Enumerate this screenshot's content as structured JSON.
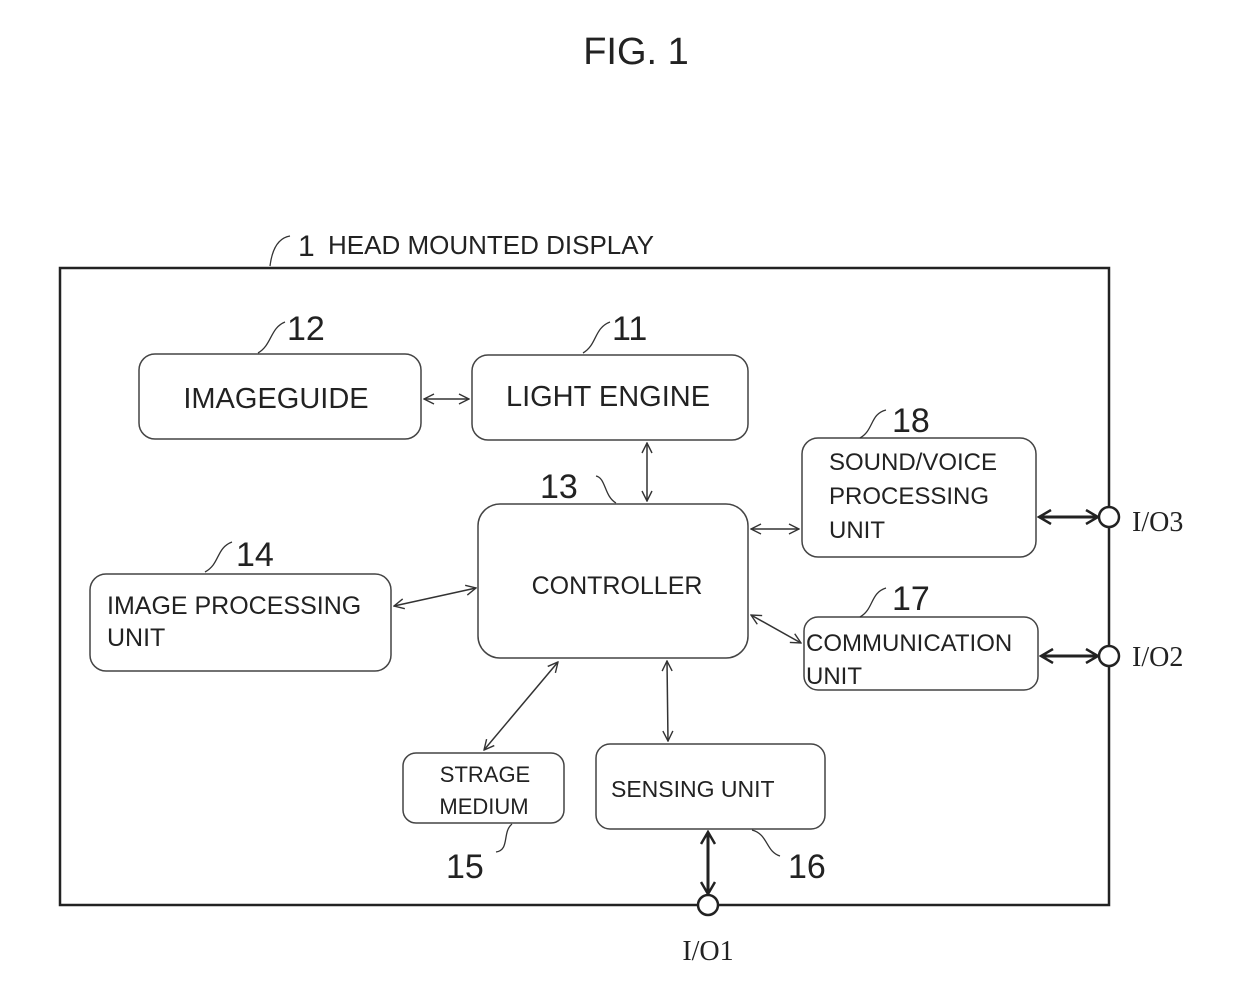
{
  "figure": {
    "title": "FIG. 1"
  },
  "system": {
    "ref": "1",
    "label": "HEAD MOUNTED DISPLAY"
  },
  "blocks": {
    "light_engine": {
      "ref": "11",
      "lines": [
        "LIGHT ENGINE"
      ]
    },
    "imageguide": {
      "ref": "12",
      "lines": [
        "IMAGEGUIDE"
      ]
    },
    "controller": {
      "ref": "13",
      "lines": [
        "CONTROLLER"
      ]
    },
    "image_processing": {
      "ref": "14",
      "lines": [
        "IMAGE PROCESSING",
        "UNIT"
      ]
    },
    "storage_medium": {
      "ref": "15",
      "lines": [
        "STRAGE",
        "MEDIUM"
      ]
    },
    "sensing": {
      "ref": "16",
      "lines": [
        "SENSING UNIT"
      ]
    },
    "communication": {
      "ref": "17",
      "lines": [
        "COMMUNICATION",
        "UNIT"
      ]
    },
    "sound_voice": {
      "ref": "18",
      "lines": [
        "SOUND/VOICE",
        "PROCESSING",
        "UNIT"
      ]
    }
  },
  "ports": {
    "io1": "I/O1",
    "io2": "I/O2",
    "io3": "I/O3"
  },
  "connections": [
    [
      "imageguide",
      "light_engine"
    ],
    [
      "light_engine",
      "controller"
    ],
    [
      "image_processing",
      "controller"
    ],
    [
      "controller",
      "sound_voice"
    ],
    [
      "controller",
      "communication"
    ],
    [
      "controller",
      "storage_medium"
    ],
    [
      "controller",
      "sensing"
    ],
    [
      "sensing",
      "io1"
    ],
    [
      "communication",
      "io2"
    ],
    [
      "sound_voice",
      "io3"
    ]
  ]
}
